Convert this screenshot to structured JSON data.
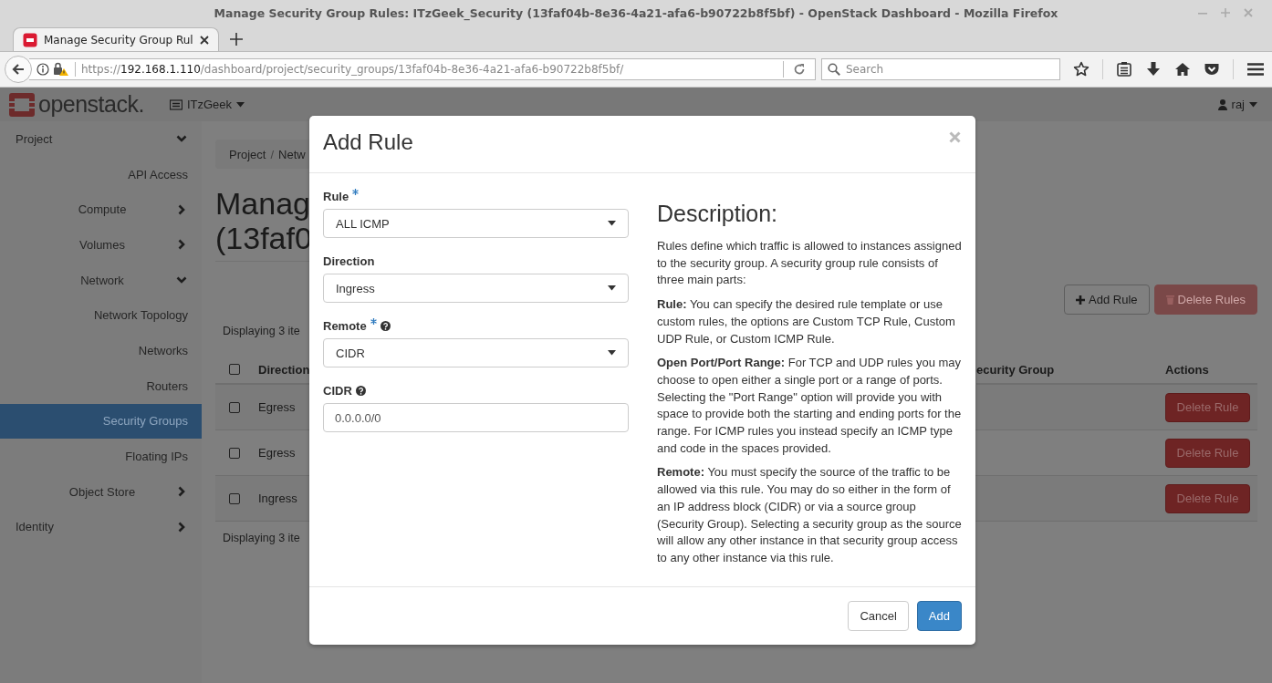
{
  "window": {
    "title": "Manage Security Group Rules: ITzGeek_Security (13faf04b-8e36-4a21-afa6-b90722b8f5bf) - OpenStack Dashboard - Mozilla Firefox"
  },
  "tabs": [
    {
      "label": "Manage Security Group Rul",
      "selected": true
    }
  ],
  "address_bar": {
    "scheme": "https://",
    "host": "192.168.1.110",
    "path": "/dashboard/project/security_groups/13faf04b-8e36-4a21-afa6-b90722b8f5bf/"
  },
  "search": {
    "placeholder": "Search"
  },
  "header": {
    "brand": "openstack.",
    "project": "ITzGeek",
    "user": "raj"
  },
  "sidebar": {
    "items": [
      {
        "label": "Project",
        "kind": "group",
        "expanded": true,
        "selected": false,
        "children": [
          {
            "label": "API Access",
            "kind": "link",
            "selected": false
          },
          {
            "label": "Compute",
            "kind": "group",
            "expanded": false,
            "selected": false
          },
          {
            "label": "Volumes",
            "kind": "group",
            "expanded": false,
            "selected": false
          },
          {
            "label": "Network",
            "kind": "group",
            "expanded": true,
            "selected": false,
            "children": [
              {
                "label": "Network Topology",
                "kind": "link",
                "selected": false
              },
              {
                "label": "Networks",
                "kind": "link",
                "selected": false
              },
              {
                "label": "Routers",
                "kind": "link",
                "selected": false
              },
              {
                "label": "Security Groups",
                "kind": "link",
                "selected": true
              },
              {
                "label": "Floating IPs",
                "kind": "link",
                "selected": false
              }
            ]
          },
          {
            "label": "Object Store",
            "kind": "group",
            "expanded": false,
            "selected": false
          }
        ]
      },
      {
        "label": "Identity",
        "kind": "group",
        "expanded": false,
        "selected": false
      }
    ]
  },
  "breadcrumb": {
    "items": [
      "Project",
      "Netw"
    ],
    "separator": "/"
  },
  "page_title": [
    "Manag",
    "(13faf0"
  ],
  "actions": [
    {
      "label": "Add Rule",
      "kind": "add",
      "disabled": false
    },
    {
      "label": "Delete Rules",
      "kind": "delete",
      "disabled": true
    }
  ],
  "table": {
    "summary_top": "Displaying 3 ite",
    "summary_bottom": "Displaying 3 ite",
    "select_all": {
      "checked": false
    },
    "columns": [
      "Direction",
      "ecurity Group",
      "Actions"
    ],
    "rows": [
      {
        "checked": false,
        "direction": "Egress",
        "action": "Delete Rule"
      },
      {
        "checked": false,
        "direction": "Egress",
        "action": "Delete Rule"
      },
      {
        "checked": false,
        "direction": "Ingress",
        "action": "Delete Rule"
      }
    ]
  },
  "modal": {
    "title": "Add Rule",
    "fields": [
      {
        "label": "Rule",
        "kind": "select",
        "required": true,
        "help": false,
        "value": "ALL ICMP"
      },
      {
        "label": "Direction",
        "kind": "select",
        "required": false,
        "help": false,
        "value": "Ingress"
      },
      {
        "label": "Remote",
        "kind": "select",
        "required": true,
        "help": true,
        "value": "CIDR"
      },
      {
        "label": "CIDR",
        "kind": "input",
        "required": false,
        "help": true,
        "value": "0.0.0.0/0"
      }
    ],
    "description_title": "Description:",
    "description": [
      "Rules define which traffic is allowed to instances assigned to the security group. A security group rule consists of three main parts:",
      "**Rule:** You can specify the desired rule template or use custom rules, the options are Custom TCP Rule, Custom UDP Rule, or Custom ICMP Rule.",
      "**Open Port/Port Range:** For TCP and UDP rules you may choose to open either a single port or a range of ports. Selecting the \"Port Range\" option will provide you with space to provide both the starting and ending ports for the range. For ICMP rules you instead specify an ICMP type and code in the spaces provided.",
      "**Remote:** You must specify the source of the traffic to be allowed via this rule. You may do so either in the form of an IP address block (CIDR) or via a source group (Security Group). Selecting a security group as the source will allow any other instance in that security group access to any other instance via this rule."
    ],
    "buttons": [
      {
        "label": "Cancel",
        "kind": "secondary"
      },
      {
        "label": "Add",
        "kind": "primary"
      }
    ]
  }
}
